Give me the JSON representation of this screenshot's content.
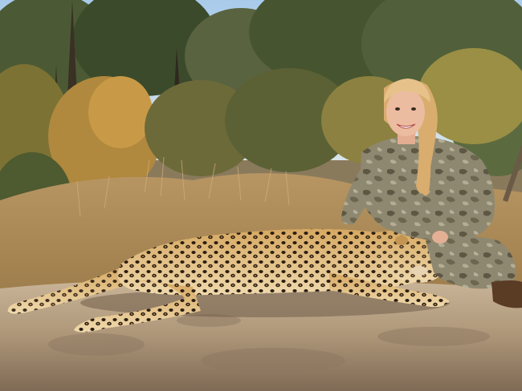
{
  "scene": {
    "subjects": [
      "person-icon",
      "leopard-icon",
      "rock-icon",
      "bush-icon",
      "tree-icon",
      "sky-icon",
      "grass-icon"
    ],
    "colors": {
      "sky": "#9fc3e6",
      "foliage_dark": "#3e4a2a",
      "foliage_mid": "#6b6a3a",
      "foliage_autumn": "#b58a3c",
      "grass": "#b89560",
      "rock": "#b9a48a",
      "rock_shadow": "#7c6a56",
      "leopard_coat": "#d9ae6a",
      "leopard_spot": "#2a1d12",
      "camo": "#8a836c",
      "hair": "#e2b87a",
      "skin": "#e9b89c"
    }
  }
}
